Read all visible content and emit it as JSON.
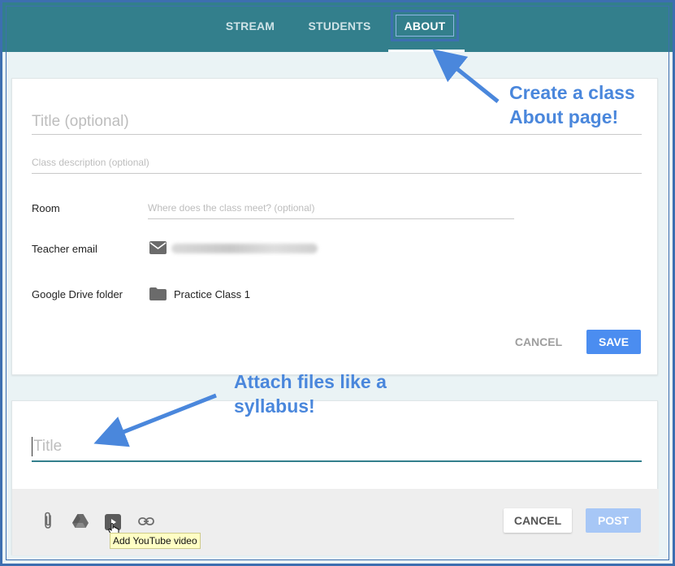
{
  "nav": {
    "tabs": [
      {
        "label": "STREAM"
      },
      {
        "label": "STUDENTS"
      },
      {
        "label": "ABOUT"
      }
    ]
  },
  "about_form": {
    "title_placeholder": "Title (optional)",
    "description_placeholder": "Class description (optional)",
    "room_label": "Room",
    "room_placeholder": "Where does the class meet? (optional)",
    "teacher_email_label": "Teacher email",
    "drive_folder_label": "Google Drive folder",
    "drive_folder_value": "Practice Class 1",
    "cancel_label": "CANCEL",
    "save_label": "SAVE"
  },
  "post_form": {
    "title_placeholder": "Title",
    "cancel_label": "CANCEL",
    "post_label": "POST",
    "tooltip": "Add YouTube video",
    "icons": [
      "paperclip-icon",
      "google-drive-icon",
      "youtube-icon",
      "link-icon"
    ]
  },
  "annotations": {
    "about_note": "Create a class About page!",
    "attach_note": "Attach files like a syllabus!"
  },
  "colors": {
    "header": "#337f8c",
    "accent_blue": "#4b8df0",
    "annotation_blue": "#4a87dc"
  }
}
